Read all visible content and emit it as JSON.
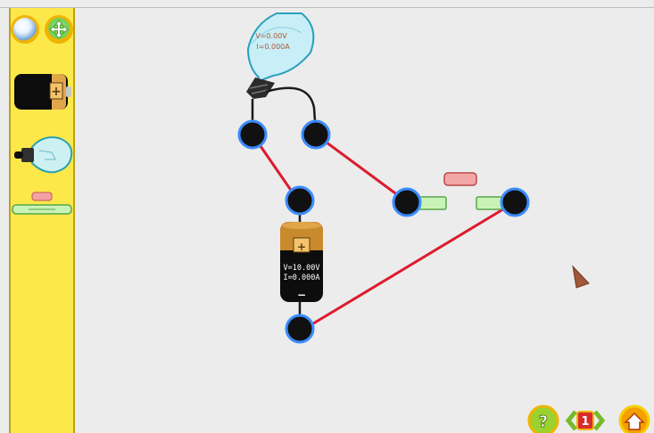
{
  "bulb": {
    "voltage": "V=0.00V",
    "current": "I=0.000A"
  },
  "battery": {
    "voltage": "V=10.00V",
    "current": "I=0.000A",
    "plus": "+",
    "minus": "−"
  },
  "palette": {
    "battery_plus": "+"
  },
  "nav": {
    "help": "?",
    "page": "1"
  },
  "colors": {
    "sidebar": "#fde84a",
    "wire": "#dd1b2e",
    "node_glow": "#3a8cff"
  },
  "icons": {
    "select_tool": "sphere-icon",
    "move_tool": "move-arrows-icon",
    "help": "help-icon",
    "prev": "chevron-left-icon",
    "next": "chevron-right-icon",
    "home": "home-icon",
    "cursor": "pointer-cursor-icon"
  }
}
